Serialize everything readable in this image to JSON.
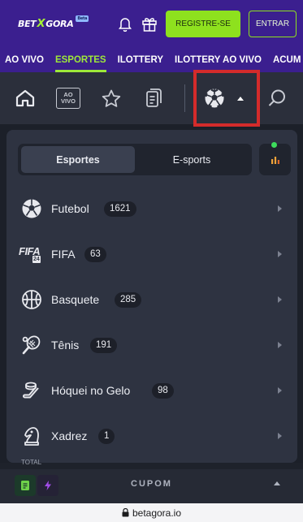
{
  "header": {
    "logo_text": "BET",
    "logo_accent": "X",
    "logo_tail": "GORA",
    "logo_badge": "Beta",
    "register_label": "REGISTRE-SE",
    "login_label": "ENTRAR"
  },
  "nav": {
    "tabs": [
      {
        "label": "AO VIVO",
        "active": false
      },
      {
        "label": "ESPORTES",
        "active": true
      },
      {
        "label": "ILOTTERY",
        "active": false
      },
      {
        "label": "ILOTTERY AO VIVO",
        "active": false
      },
      {
        "label": "ACUM",
        "active": false
      }
    ]
  },
  "icon_row": {
    "live_icon_text_1": "AO",
    "live_icon_text_2": "VIVO"
  },
  "panel": {
    "tabs": [
      {
        "label": "Esportes",
        "active": true
      },
      {
        "label": "E-sports",
        "active": false
      }
    ],
    "sports": [
      {
        "name": "Futebol",
        "count": "1621",
        "icon": "soccer-ball-icon"
      },
      {
        "name": "FIFA",
        "count": "63",
        "icon": "fifa-24-icon",
        "icon_text": "FIFA",
        "icon_sub": "24"
      },
      {
        "name": "Basquete",
        "count": "285",
        "icon": "basketball-icon"
      },
      {
        "name": "Tênis",
        "count": "191",
        "icon": "tennis-icon"
      },
      {
        "name": "Hóquei no Gelo",
        "count": "98",
        "icon": "ice-hockey-icon"
      },
      {
        "name": "Xadrez",
        "count": "1",
        "icon": "chess-knight-icon"
      }
    ]
  },
  "bottom": {
    "under_label": "TOTAL",
    "coupon_label": "CUPOM",
    "url": "betagora.io"
  },
  "colors": {
    "brand_purple": "#3b1f8f",
    "accent_green": "#8ee11e",
    "highlight_red": "#d42b2b",
    "panel_bg": "#2e3341"
  }
}
